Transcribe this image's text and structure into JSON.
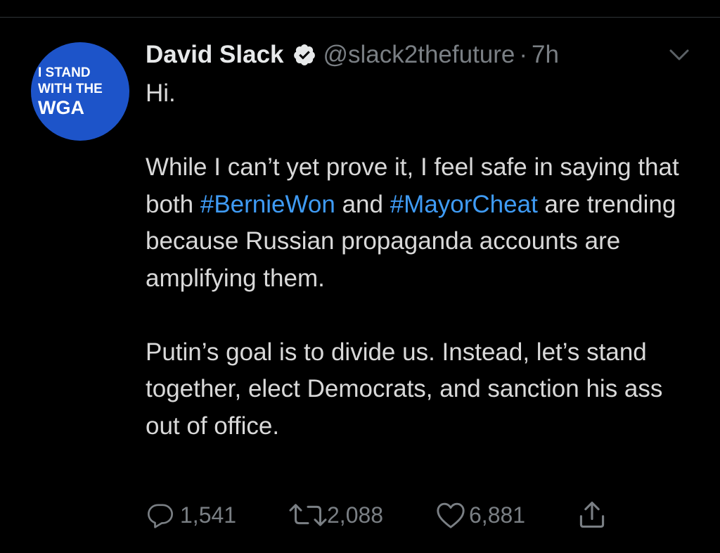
{
  "avatar": {
    "line1": "I STAND",
    "line2": "WITH THE",
    "line3": "WGA",
    "color": "#1d54c9"
  },
  "tweet": {
    "display_name": "David Slack",
    "handle": "@slack2thefuture",
    "separator": "·",
    "time": "7h",
    "greeting": "Hi.",
    "para2_part1": "While I can’t yet prove it, I feel safe in saying that both ",
    "hashtag1": "#BernieWon",
    "para2_part2": " and ",
    "hashtag2": "#MayorCheat",
    "para2_part3": " are trending because Russian propaganda accounts are amplifying them.",
    "para3": "Putin’s goal is to divide us. Instead, let’s stand together, elect Democrats, and sanction his ass out of office.",
    "hashtag_color": "#3f9bf4"
  },
  "actions": {
    "reply_count": "1,541",
    "retweet_count": "2,088",
    "like_count": "6,881",
    "icons": [
      "reply-icon",
      "retweet-icon",
      "like-icon",
      "share-icon"
    ]
  }
}
